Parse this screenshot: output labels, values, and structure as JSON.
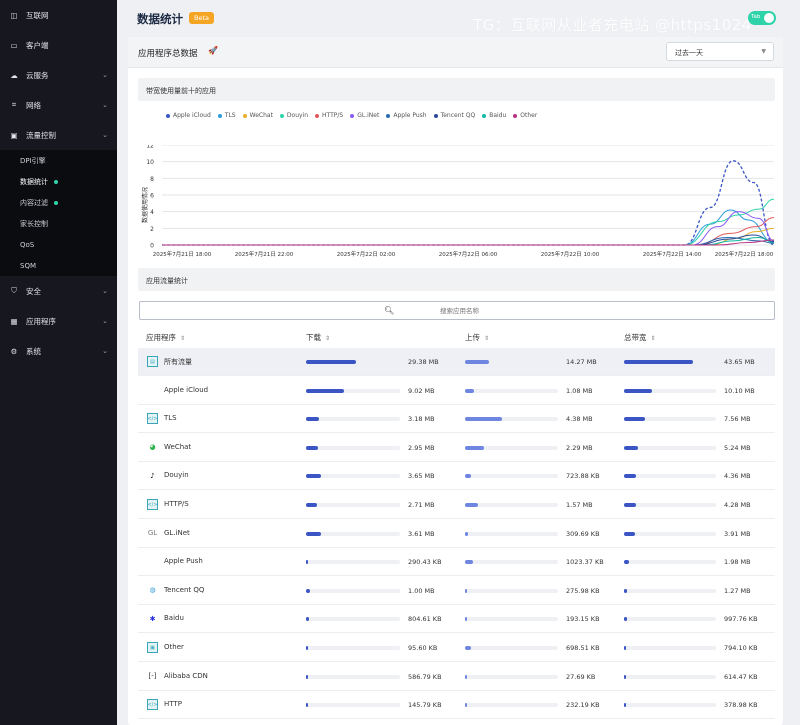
{
  "sidebar": {
    "items": [
      {
        "label": "互联网",
        "icon": "globe-icon",
        "chevron": false
      },
      {
        "label": "客户端",
        "icon": "devices-icon",
        "chevron": false
      },
      {
        "label": "云服务",
        "icon": "cloud-icon",
        "chevron": true
      },
      {
        "label": "网络",
        "icon": "network-icon",
        "chevron": true
      },
      {
        "label": "流量控制",
        "icon": "traffic-icon",
        "chevron": true
      }
    ],
    "sub_items": [
      {
        "label": "DPI引擎",
        "active": false,
        "dot": false
      },
      {
        "label": "数据统计",
        "active": true,
        "dot": true
      },
      {
        "label": "内容过滤",
        "active": false,
        "dot": true
      },
      {
        "label": "家长控制",
        "active": false,
        "dot": false
      },
      {
        "label": "QoS",
        "active": false,
        "dot": false
      },
      {
        "label": "SQM",
        "active": false,
        "dot": false
      }
    ],
    "bottom_items": [
      {
        "label": "安全",
        "icon": "shield-icon"
      },
      {
        "label": "应用程序",
        "icon": "apps-icon"
      },
      {
        "label": "系统",
        "icon": "gear-icon"
      }
    ]
  },
  "header": {
    "title": "数据统计",
    "badge": "Beta",
    "watermark": "TG：互联网从业者充电站 @https1024",
    "toggle_label": "Tab"
  },
  "card": {
    "title": "应用程序总数据",
    "range_select": "过去一天",
    "chart_section_title": "带宽使用量前十的应用",
    "table_section_title": "应用流量统计",
    "search_placeholder": "搜索应用名称"
  },
  "table": {
    "headers": {
      "app": "应用程序",
      "download": "下载",
      "upload": "上传",
      "total": "总带宽"
    },
    "rows": [
      {
        "name": "所有流量",
        "icon": "all-traffic-icon",
        "down": "29.38 MB",
        "up": "14.27 MB",
        "total": "43.65 MB",
        "down_frac": 1.0,
        "up_frac": 1.0,
        "total_frac": 1.0
      },
      {
        "name": "Apple iCloud",
        "icon": "apple-icon",
        "down": "9.02 MB",
        "up": "1.08 MB",
        "total": "10.10 MB",
        "down_frac": 0.307,
        "up_frac": 0.076,
        "total_frac": 0.231
      },
      {
        "name": "TLS",
        "icon": "code-icon",
        "down": "3.18 MB",
        "up": "4.38 MB",
        "total": "7.56 MB",
        "down_frac": 0.108,
        "up_frac": 0.307,
        "total_frac": 0.173
      },
      {
        "name": "WeChat",
        "icon": "wechat-icon",
        "down": "2.95 MB",
        "up": "2.29 MB",
        "total": "5.24 MB",
        "down_frac": 0.1,
        "up_frac": 0.16,
        "total_frac": 0.12
      },
      {
        "name": "Douyin",
        "icon": "douyin-icon",
        "down": "3.65 MB",
        "up": "723.88 KB",
        "total": "4.36 MB",
        "down_frac": 0.124,
        "up_frac": 0.05,
        "total_frac": 0.1
      },
      {
        "name": "HTTP/S",
        "icon": "code-icon",
        "down": "2.71 MB",
        "up": "1.57 MB",
        "total": "4.28 MB",
        "down_frac": 0.092,
        "up_frac": 0.11,
        "total_frac": 0.098
      },
      {
        "name": "GL.iNet",
        "icon": "glinet-icon",
        "down": "3.61 MB",
        "up": "309.69 KB",
        "total": "3.91 MB",
        "down_frac": 0.123,
        "up_frac": 0.021,
        "total_frac": 0.09
      },
      {
        "name": "Apple Push",
        "icon": "apple-icon",
        "down": "290.43 KB",
        "up": "1023.37 KB",
        "total": "1.98 MB",
        "down_frac": 0.01,
        "up_frac": 0.07,
        "total_frac": 0.045
      },
      {
        "name": "Tencent QQ",
        "icon": "qq-icon",
        "down": "1.00 MB",
        "up": "275.98 KB",
        "total": "1.27 MB",
        "down_frac": 0.034,
        "up_frac": 0.019,
        "total_frac": 0.029
      },
      {
        "name": "Baidu",
        "icon": "baidu-icon",
        "down": "804.61 KB",
        "up": "193.15 KB",
        "total": "997.76 KB",
        "down_frac": 0.027,
        "up_frac": 0.013,
        "total_frac": 0.022
      },
      {
        "name": "Other",
        "icon": "other-icon",
        "down": "95.60 KB",
        "up": "698.51 KB",
        "total": "794.10 KB",
        "down_frac": 0.003,
        "up_frac": 0.048,
        "total_frac": 0.018
      },
      {
        "name": "Alibaba CDN",
        "icon": "alibaba-icon",
        "down": "586.79 KB",
        "up": "27.69 KB",
        "total": "614.47 KB",
        "down_frac": 0.02,
        "up_frac": 0.002,
        "total_frac": 0.014
      },
      {
        "name": "HTTP",
        "icon": "code-icon",
        "down": "145.79 KB",
        "up": "232.19 KB",
        "total": "378.98 KB",
        "down_frac": 0.005,
        "up_frac": 0.016,
        "total_frac": 0.009
      }
    ]
  },
  "chart_data": {
    "type": "line",
    "title": "",
    "xlabel": "",
    "ylabel": "数据使用情况",
    "ylim": [
      0,
      12
    ],
    "yticks": [
      0,
      2,
      4,
      6,
      8,
      10,
      12
    ],
    "x_tick_labels": [
      "2025年7月21日 18:00",
      "2025年7月21日 22:00",
      "2025年7月22日 02:00",
      "2025年7月22日 06:00",
      "2025年7月22日 10:00",
      "2025年7月22日 14:00",
      "2025年7月22日 18:00"
    ],
    "x_range": [
      0,
      24
    ],
    "grid": true,
    "legend_position": "top",
    "series": [
      {
        "name": "Apple iCloud",
        "color": "#3b55c4",
        "dashed": true,
        "x": [
          0,
          20.5,
          21.5,
          22.4,
          23.2,
          24
        ],
        "y": [
          0,
          0,
          4.5,
          10.1,
          7.5,
          0
        ]
      },
      {
        "name": "TLS",
        "color": "#2d9cdb",
        "dashed": false,
        "x": [
          0,
          20.5,
          21.5,
          22.3,
          23.0,
          24
        ],
        "y": [
          0,
          0,
          2.5,
          4.2,
          3.0,
          0.3
        ]
      },
      {
        "name": "WeChat",
        "color": "#e8b02a",
        "dashed": false,
        "x": [
          0,
          21.5,
          22.5,
          23.3,
          24
        ],
        "y": [
          0,
          0,
          0.8,
          1.6,
          2.0
        ]
      },
      {
        "name": "Douyin",
        "color": "#2fd3a9",
        "dashed": false,
        "x": [
          0,
          20.5,
          21.8,
          22.6,
          23.4,
          24
        ],
        "y": [
          0,
          0,
          2.8,
          3.6,
          4.3,
          5.5
        ]
      },
      {
        "name": "HTTP/S",
        "color": "#e05a5a",
        "dashed": false,
        "x": [
          0,
          21.0,
          22.3,
          23.3,
          24
        ],
        "y": [
          0,
          0,
          1.4,
          2.2,
          3.3
        ]
      },
      {
        "name": "GL.iNet",
        "color": "#8b5cf6",
        "dashed": false,
        "x": [
          0,
          20.8,
          21.8,
          22.6,
          23.4,
          24
        ],
        "y": [
          0,
          0,
          2.2,
          4.0,
          3.2,
          0.5
        ]
      },
      {
        "name": "Apple Push",
        "color": "#2b6cb0",
        "dashed": false,
        "x": [
          0,
          20.8,
          22.2,
          23.4,
          24
        ],
        "y": [
          0,
          0,
          0.9,
          0.5,
          0.2
        ]
      },
      {
        "name": "Tencent QQ",
        "color": "#2a4a9a",
        "dashed": false,
        "x": [
          0,
          21.0,
          22.2,
          23.2,
          24
        ],
        "y": [
          0,
          0,
          0.7,
          1.2,
          0.4
        ]
      },
      {
        "name": "Baidu",
        "color": "#14b8a6",
        "dashed": false,
        "x": [
          0,
          21.3,
          22.4,
          23.4,
          24
        ],
        "y": [
          0,
          0,
          0.5,
          0.9,
          0.3
        ]
      },
      {
        "name": "Other",
        "color": "#b83280",
        "dashed": false,
        "x": [
          0,
          21.8,
          23.0,
          24
        ],
        "y": [
          0,
          0,
          0.3,
          0.6
        ]
      }
    ]
  }
}
